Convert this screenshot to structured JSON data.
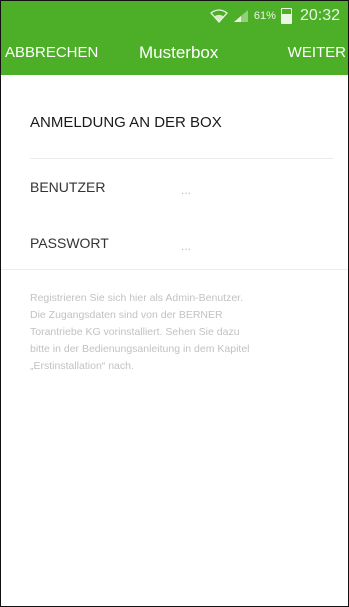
{
  "statusbar": {
    "battery_percent": "61%",
    "time": "20:32",
    "battery_level": 0.61
  },
  "appbar": {
    "cancel_label": "ABBRECHEN",
    "title": "Musterbox",
    "next_label": "WEITER"
  },
  "form": {
    "section_title": "ANMELDUNG AN DER BOX",
    "user_label": "BENUTZER",
    "user_placeholder": "...",
    "password_label": "PASSWORT",
    "password_placeholder": "..."
  },
  "info": {
    "lines": [
      "Registrieren Sie sich hier als Admin-Benutzer.",
      "Die Zugangsdaten sind von der BERNER",
      "Torantriebe KG vorinstalliert. Sehen Sie dazu",
      "bitte in der Bedienungsanleitung in dem Kapitel",
      "„Erstinstallation“ nach."
    ]
  },
  "colors": {
    "primary": "#4caf27"
  }
}
